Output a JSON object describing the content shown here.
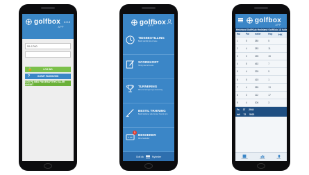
{
  "brand": {
    "logo_text": "golfbox",
    "sub": "APP",
    "version": "2.0.0"
  },
  "login": {
    "username_value": "55-1760",
    "password_value": "",
    "buttons": [
      {
        "label": "LOG IND",
        "icon": "lock-icon"
      },
      {
        "label": "GLEMT PASSWORD",
        "icon": "question-icon"
      },
      {
        "label": "LOG PÅ MED FINGERAFTRYK ELLER ANSIGT",
        "icon": ""
      }
    ]
  },
  "menu": {
    "items": [
      {
        "title": "TIDSBESTILLING",
        "desc": "Bestil starttid på en bane",
        "icon": "clock-icon"
      },
      {
        "title": "SCOREKORT",
        "desc": "Hurtig start af runde",
        "icon": "scorecard-icon"
      },
      {
        "title": "TURNERING",
        "desc": "Mine turneringer og Livescoring",
        "icon": "trophy-icon"
      },
      {
        "title": "BESTIL TRÆNING",
        "desc": "Bestil lektioner eller kurser hos din pro",
        "icon": "golf-club-icon"
      },
      {
        "title": "BESKEDER",
        "desc": "Mine beskeder",
        "icon": "message-icon",
        "badge": "1"
      }
    ],
    "footer": {
      "left": "Golf.dk",
      "right": "Nyheder"
    }
  },
  "scorecard": {
    "course": "Hedeland GolfKlub Hedeland GolfKlub 18 huller",
    "headers": [
      "Hul",
      "Par",
      "meter",
      "Hcp",
      "HK"
    ],
    "rows": [
      [
        "1",
        "5",
        "380",
        "5"
      ],
      [
        "2",
        "4",
        "283",
        "11"
      ],
      [
        "3",
        "3",
        "155",
        "15"
      ],
      [
        "4",
        "5",
        "462",
        "7"
      ],
      [
        "5",
        "4",
        "339",
        "9"
      ],
      [
        "6",
        "5",
        "415",
        "1"
      ],
      [
        "7",
        "4",
        "385",
        "13"
      ],
      [
        "8",
        "3",
        "112",
        "17"
      ],
      [
        "9",
        "4",
        "306",
        "3"
      ]
    ],
    "totals": [
      {
        "label": "Fs",
        "par": "37",
        "meter": "2944"
      },
      {
        "label": "Ialt",
        "par": "72",
        "meter": "5922"
      }
    ],
    "nav": [
      "Scorekort",
      "Statistik",
      "Baner"
    ]
  }
}
